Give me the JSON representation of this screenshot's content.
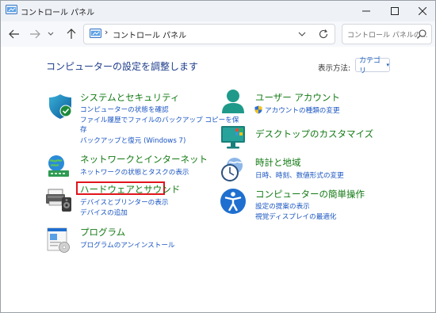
{
  "window": {
    "title": "コントロール パネル"
  },
  "address": {
    "path": "コントロール パネル",
    "separator": "›"
  },
  "search": {
    "placeholder": "コントロール パネルの..."
  },
  "heading": "コンピューターの設定を調整します",
  "view_by": {
    "label": "表示方法:",
    "value": "カテゴリ"
  },
  "left_categories": [
    {
      "title": "システムとセキュリティ",
      "icon": "shield-icon",
      "links": [
        "コンピューターの状態を確認",
        "ファイル履歴でファイルのバックアップ コピーを保",
        "存",
        "バックアップと復元 (Windows 7)"
      ]
    },
    {
      "title": "ネットワークとインターネット",
      "icon": "network-globe-icon",
      "links": [
        "ネットワークの状態とタスクの表示"
      ]
    },
    {
      "title": "ハードウェアとサウンド",
      "icon": "printer-speaker-icon",
      "links": [
        "デバイスとプリンターの表示",
        "デバイスの追加"
      ]
    },
    {
      "title": "プログラム",
      "icon": "programs-icon",
      "links": [
        "プログラムのアンインストール"
      ]
    }
  ],
  "right_categories": [
    {
      "title": "ユーザー アカウント",
      "icon": "user-icon",
      "links": [
        "アカウントの種類の変更"
      ]
    },
    {
      "title": "デスクトップのカスタマイズ",
      "icon": "monitor-icon",
      "links": []
    },
    {
      "title": "時計と地域",
      "icon": "clock-globe-icon",
      "links": [
        "日時、時刻、数値形式の変更"
      ]
    },
    {
      "title": "コンピューターの簡単操作",
      "icon": "accessibility-icon",
      "links": [
        "設定の提案の表示",
        "視覚ディスプレイの最適化"
      ]
    }
  ],
  "colors": {
    "title_green": "#127a13",
    "link_blue": "#1a55c2",
    "heading_blue": "#1e3e8c",
    "highlight_red": "#e0151b"
  }
}
